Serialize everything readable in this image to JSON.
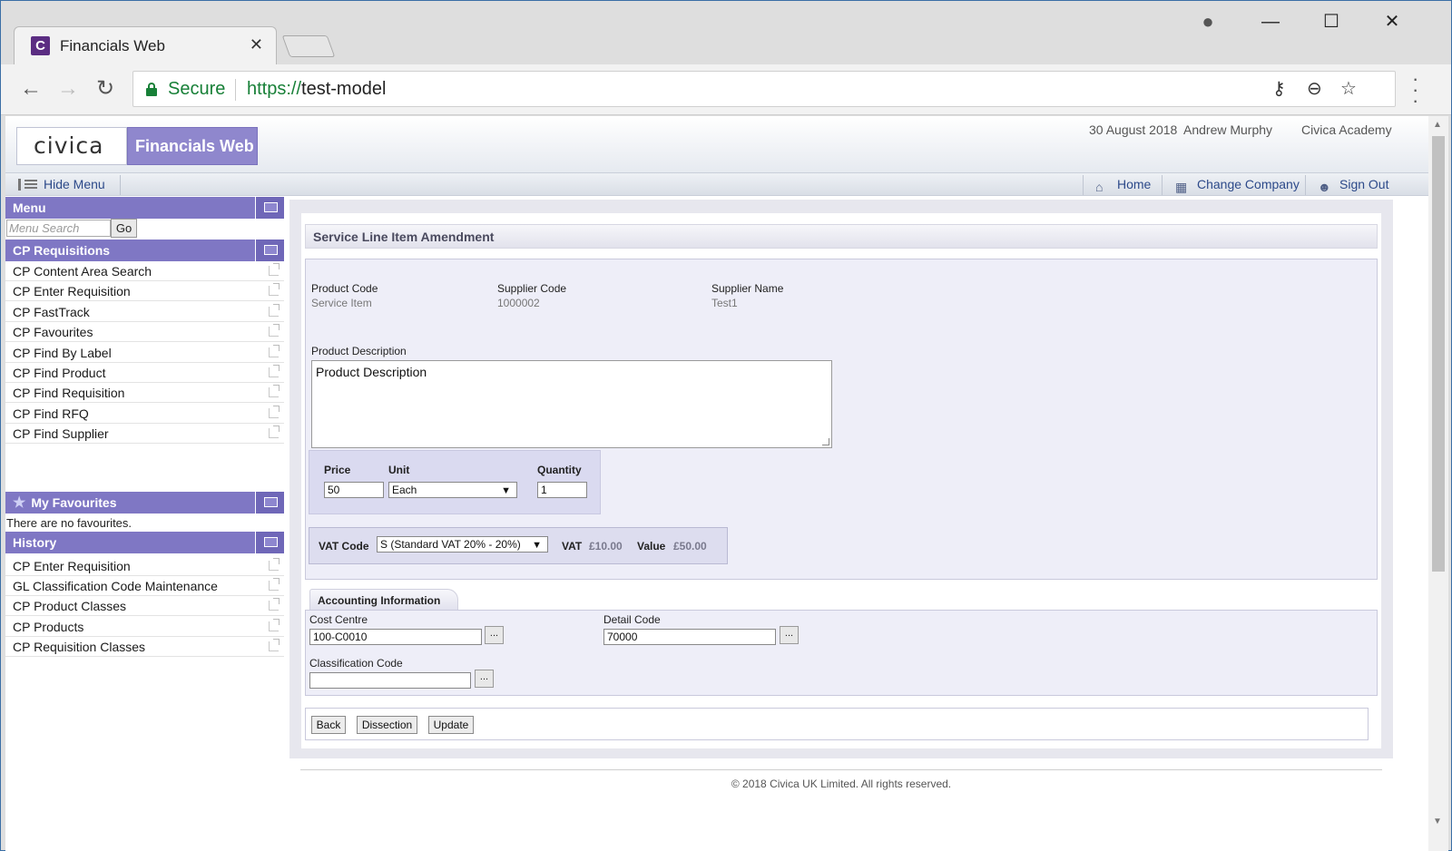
{
  "browser": {
    "tab_title": "Financials Web",
    "tab_favicon_letter": "C",
    "secure_label": "Secure",
    "url_scheme": "https://",
    "url_host": "test-model"
  },
  "header": {
    "logo": "civica",
    "product_name": "Financials Web",
    "date": "30 August 2018",
    "user": "Andrew Murphy",
    "company": "Civica Academy"
  },
  "menubar": {
    "hide_menu": "Hide Menu",
    "home": "Home",
    "change_company": "Change Company",
    "sign_out": "Sign Out"
  },
  "sidebar": {
    "menu_title": "Menu",
    "search_placeholder": "Menu Search",
    "go_label": "Go",
    "cp_title": "CP Requisitions",
    "cp_items": [
      "CP Content Area Search",
      "CP Enter Requisition",
      "CP FastTrack",
      "CP Favourites",
      "CP Find By Label",
      "CP Find Product",
      "CP Find Requisition",
      "CP Find RFQ",
      "CP Find Supplier"
    ],
    "fav_title": "My Favourites",
    "no_favs": "There are no favourites.",
    "history_title": "History",
    "history_items": [
      "CP Enter Requisition",
      "GL Classification Code Maintenance",
      "CP Product Classes",
      "CP Products",
      "CP Requisition Classes"
    ]
  },
  "form": {
    "title": "Service Line Item Amendment",
    "product_code_label": "Product Code",
    "product_code_value": "Service Item",
    "supplier_code_label": "Supplier Code",
    "supplier_code_value": "1000002",
    "supplier_name_label": "Supplier Name",
    "supplier_name_value": "Test1",
    "description_label": "Product Description",
    "description_value": "Product Description",
    "price_label": "Price",
    "price_value": "50",
    "unit_label": "Unit",
    "unit_value": "Each",
    "quantity_label": "Quantity",
    "quantity_value": "1",
    "vat_code_label": "VAT Code",
    "vat_code_value": "S (Standard VAT 20% - 20%)",
    "vat_label": "VAT",
    "vat_value": "£10.00",
    "value_label": "Value",
    "value_value": "£50.00"
  },
  "accounting": {
    "tab_label": "Accounting Information",
    "cost_centre_label": "Cost Centre",
    "cost_centre_value": "100-C0010",
    "detail_code_label": "Detail Code",
    "detail_code_value": "70000",
    "classification_label": "Classification Code",
    "classification_value": "",
    "lookup_label": "..."
  },
  "buttons": {
    "back": "Back",
    "dissection": "Dissection",
    "update": "Update"
  },
  "footer": "© 2018 Civica UK Limited. All rights reserved."
}
